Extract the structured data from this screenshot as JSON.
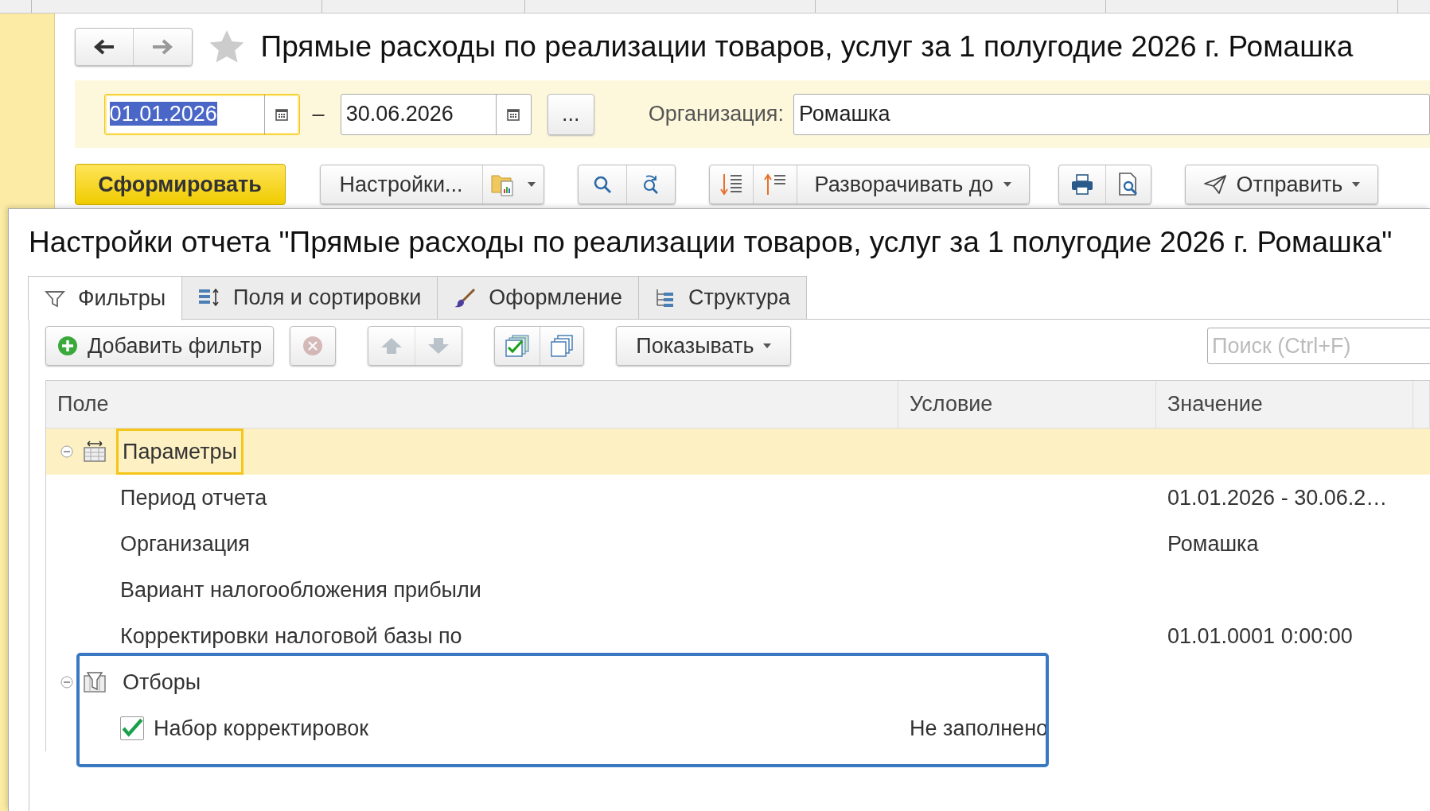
{
  "report": {
    "title": "Прямые расходы по реализации товаров, услуг за 1 полугодие 2026 г. Ромашка",
    "period_from": "01.01.2026",
    "period_separator": "–",
    "period_to": "30.06.2026",
    "period_button": "...",
    "organization_label": "Организация:",
    "organization": "Ромашка"
  },
  "toolbar": {
    "generate": "Сформировать",
    "settings": "Настройки...",
    "expand": "Разворачивать до",
    "send": "Отправить"
  },
  "settings": {
    "title": "Настройки отчета \"Прямые расходы по реализации товаров, услуг за 1 полугодие 2026 г. Ромашка\"",
    "tabs": [
      {
        "kind": "filters",
        "label": "Фильтры",
        "selected": true
      },
      {
        "kind": "fields",
        "label": "Поля и сортировки",
        "selected": false
      },
      {
        "kind": "appearance",
        "label": "Оформление",
        "selected": false
      },
      {
        "kind": "structure",
        "label": "Структура",
        "selected": false
      }
    ],
    "toolbar": {
      "add_filter": "Добавить фильтр",
      "show": "Показывать",
      "search_placeholder": "Поиск (Ctrl+F)"
    },
    "columns": [
      "Поле",
      "Условие",
      "Значение"
    ],
    "rows": [
      {
        "kind": "parameters",
        "label": "Параметры",
        "expanded": true,
        "selected": true,
        "highlighted": false,
        "children": [
          {
            "field": "Период отчета",
            "value": "01.01.2026 - 30.06.2…"
          },
          {
            "field": "Организация",
            "value": "Ромашка"
          },
          {
            "field": "Вариант налогообложения прибыли"
          },
          {
            "field": "Корректировки налоговой базы по",
            "value": "01.01.0001 0:00:00"
          }
        ]
      },
      {
        "kind": "filters",
        "label": "Отборы",
        "expanded": true,
        "selected": false,
        "highlighted": true,
        "children": [
          {
            "field": "Набор корректировок",
            "checked": true,
            "condition": "Не заполнено"
          }
        ]
      }
    ]
  }
}
